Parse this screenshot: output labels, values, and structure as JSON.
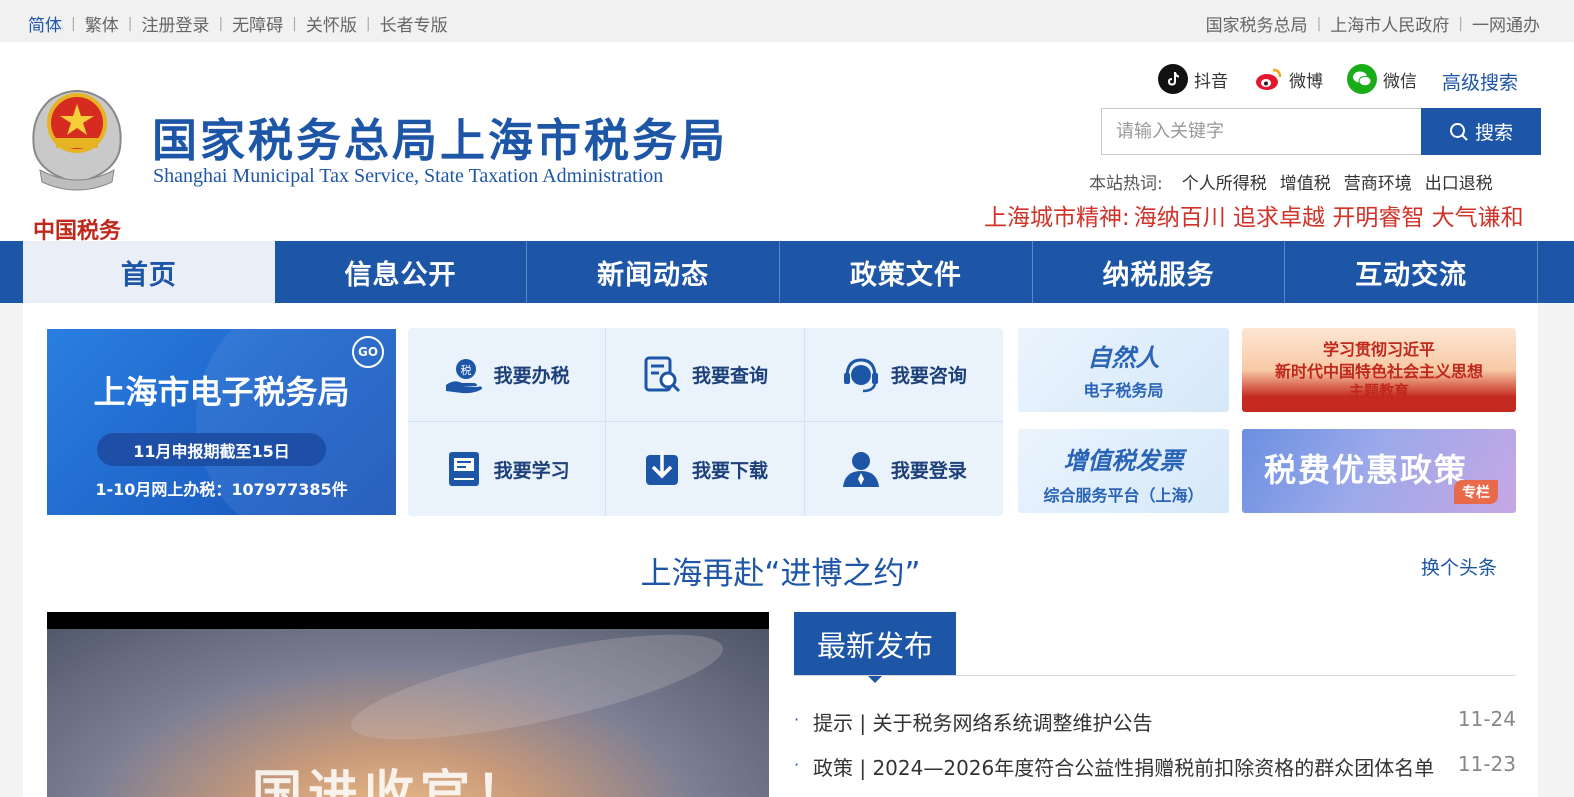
{
  "topbar": {
    "left_links": [
      {
        "label": "简体",
        "active": true
      },
      {
        "label": "繁体",
        "active": false
      },
      {
        "label": "注册登录",
        "active": false
      },
      {
        "label": "无障碍",
        "active": false
      },
      {
        "label": "关怀版",
        "active": false
      },
      {
        "label": "长者专版",
        "active": false
      }
    ],
    "right_links": [
      {
        "label": "国家税务总局"
      },
      {
        "label": "上海市人民政府"
      },
      {
        "label": "一网通办"
      }
    ]
  },
  "header": {
    "logo_text": "中国税务",
    "title": "国家税务总局上海市税务局",
    "subtitle": "Shanghai Municipal Tax Service, State Taxation Administration",
    "social": [
      {
        "icon": "douyin-icon",
        "label": "抖音",
        "color": "#111111"
      },
      {
        "icon": "weibo-icon",
        "label": "微博",
        "color": "#e6162d"
      },
      {
        "icon": "wechat-icon",
        "label": "微信",
        "color": "#1aad19"
      }
    ],
    "advanced_search": "高级搜索",
    "search": {
      "placeholder": "请输入关键字",
      "button": "搜索"
    },
    "hotwords": {
      "label": "本站热词:",
      "items": [
        "个人所得税",
        "增值税",
        "营商环境",
        "出口退税"
      ]
    },
    "spirit": {
      "label": "上海城市精神:",
      "text": "海纳百川 追求卓越 开明睿智 大气谦和"
    }
  },
  "nav": {
    "items": [
      {
        "label": "首页",
        "active": true
      },
      {
        "label": "信息公开",
        "active": false
      },
      {
        "label": "新闻动态",
        "active": false
      },
      {
        "label": "政策文件",
        "active": false
      },
      {
        "label": "纳税服务",
        "active": false
      },
      {
        "label": "互动交流",
        "active": false
      }
    ]
  },
  "etax": {
    "go": "GO",
    "title": "上海市电子税务局",
    "deadline": "11月申报期截至15日",
    "stat": "1-10月网上办税：107977385件"
  },
  "quick_links": [
    {
      "label": "我要办税",
      "icon": "hand-tax-icon"
    },
    {
      "label": "我要查询",
      "icon": "query-icon"
    },
    {
      "label": "我要咨询",
      "icon": "headset-icon"
    },
    {
      "label": "我要学习",
      "icon": "book-icon"
    },
    {
      "label": "我要下载",
      "icon": "download-icon"
    },
    {
      "label": "我要登录",
      "icon": "user-icon"
    }
  ],
  "banners": {
    "natural": {
      "title": "自然人",
      "sub": "电子税务局"
    },
    "study": {
      "line1": "学习贯彻习近平",
      "line2": "新时代中国特色社会主义思想",
      "line3": "主题教育"
    },
    "vat": {
      "title": "增值税发票",
      "sub": "综合服务平台（上海）"
    },
    "policy": {
      "title": "税费优惠政策",
      "tag": "专栏"
    }
  },
  "headline": {
    "title": "上海再赴“进博之约”",
    "switch": "换个头条"
  },
  "photo": {
    "overlay": "国进收官！"
  },
  "latest": {
    "tab": "最新发布",
    "items": [
      {
        "text": "提示 | 关于税务网络系统调整维护公告",
        "date": "11-24"
      },
      {
        "text": "政策 | 2024—2026年度符合公益性捐赠税前扣除资格的群众团体名单",
        "date": "11-23"
      }
    ]
  }
}
